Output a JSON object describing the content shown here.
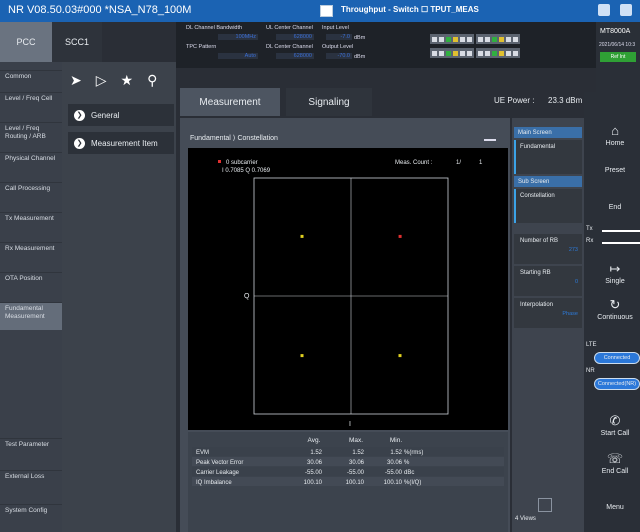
{
  "titlebar": {
    "title": "NR V08.50.03#000 *NSA_N78_100M",
    "center": "Throughput - Switch ☐ TPUT_MEAS"
  },
  "carrier_tabs": [
    "PCC",
    "SCC1"
  ],
  "left_nav": [
    "Common",
    "Level / Freq Cell",
    "Level / Freq Routing / ARB",
    "Physical Channel",
    "Call Processing",
    "Tx Measurement",
    "Rx Measurement",
    "OTA Position",
    "Fundamental Measurement",
    "Test Parameter",
    "External Loss",
    "System Config"
  ],
  "menu": {
    "items": [
      "General",
      "Measurement Item"
    ]
  },
  "top_info": {
    "dl_bw_label": "DL Channel Bandwidth",
    "dl_bw_value": "100MHz",
    "tpc_label": "TPC Pattern",
    "tpc_value": "Auto",
    "ul_center_label": "UL Center Channel",
    "ul_center_value": "628000",
    "dl_center_label": "DL Center Channel",
    "dl_center_value": "628000",
    "input_label": "Input Level",
    "input_value": "-7.0",
    "output_label": "Output Level",
    "output_value": "-70.0",
    "unit": "dBm"
  },
  "instrument": {
    "name": "MT8000A",
    "date": "2021/06/14 10:3",
    "status": "Ref Int"
  },
  "tabs": {
    "measurement": "Measurement",
    "signaling": "Signaling"
  },
  "ue_power": {
    "label": "UE Power :",
    "value": "23.3 dBm"
  },
  "plot": {
    "title": "Fundamental ⟩ Constellation",
    "subcarrier": "0 subcarrier",
    "iq": "I 0.7085 Q 0.7069",
    "meas_count_label": "Meas. Count :",
    "meas_count": "1/",
    "meas_total": "1",
    "axis_q": "Q",
    "axis_i": "I"
  },
  "chart_data": {
    "type": "scatter",
    "xlabel": "I",
    "ylabel": "Q",
    "xlim": [
      -1.4,
      1.4
    ],
    "ylim": [
      -1.4,
      1.4
    ],
    "points": [
      {
        "i": 0.7085,
        "q": 0.7069,
        "color": "#e03030"
      },
      {
        "i": -0.7071,
        "q": 0.7071,
        "color": "#e0d020"
      },
      {
        "i": -0.7071,
        "q": -0.7071,
        "color": "#e0d020"
      },
      {
        "i": 0.7071,
        "q": -0.7071,
        "color": "#e0d020"
      }
    ]
  },
  "results": {
    "headers": [
      "Avg.",
      "Max.",
      "Min."
    ],
    "rows": [
      {
        "name": "EVM",
        "avg": "1.52",
        "max": "1.52",
        "min": "1.52",
        "unit": "%(rms)"
      },
      {
        "name": "Peak Vector Error",
        "avg": "30.06",
        "max": "30.06",
        "min": "30.06",
        "unit": "%"
      },
      {
        "name": "Carrier Leakage",
        "avg": "-55.00",
        "max": "-55.00",
        "min": "-55.00",
        "unit": "dBc"
      },
      {
        "name": "IQ Imbalance",
        "avg": "100.10",
        "max": "100.10",
        "min": "100.10",
        "unit": "%(I/Q)"
      }
    ]
  },
  "side_panel": {
    "main_screen": "Main Screen",
    "fundamental": "Fundamental",
    "sub_screen": "Sub Screen",
    "constellation": "Constellation",
    "number_of_rb": "Number of RB",
    "number_of_rb_value": "273",
    "starting_rb": "Starting RB",
    "starting_rb_value": "0",
    "interpolation": "Interpolation",
    "interpolation_value": "Phase",
    "views": "4 Views"
  },
  "right_bar": {
    "home": "Home",
    "preset": "Preset",
    "end": "End",
    "tx": "Tx",
    "rx": "Rx",
    "single": "Single",
    "continuous": "Continuous",
    "lte": "LTE",
    "lte_state": "Connected",
    "nr": "NR",
    "nr_state": "Connected(NR)",
    "start_call": "Start Call",
    "end_call": "End Call",
    "menu": "Menu"
  },
  "colors": {
    "titlebar": "#1b63b3",
    "accent": "#2b78d9",
    "ok": "#2fa035"
  }
}
